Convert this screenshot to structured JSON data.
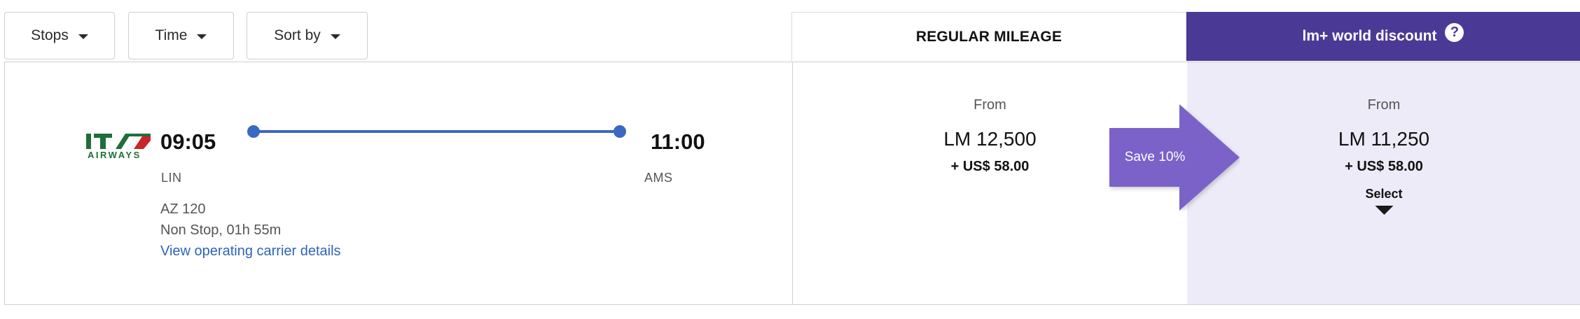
{
  "filters": {
    "stops_label": "Stops",
    "time_label": "Time",
    "sort_label": "Sort by"
  },
  "columns": {
    "regular_title": "REGULAR MILEAGE",
    "discount_title": "lm+ world discount",
    "help_symbol": "?"
  },
  "flight": {
    "airline_logo_text": "AIRWAYS",
    "departure_time": "09:05",
    "arrival_time": "11:00",
    "origin": "LIN",
    "destination": "AMS",
    "flight_number": "AZ 120",
    "duration": "Non Stop, 01h 55m",
    "carrier_link": "View operating carrier details"
  },
  "fares": {
    "regular": {
      "from_label": "From",
      "miles": "LM 12,500",
      "tax": "+ US$ 58.00"
    },
    "discount": {
      "from_label": "From",
      "miles": "LM 11,250",
      "tax": "+ US$ 58.00",
      "select_label": "Select"
    },
    "save_badge": "Save 10%"
  },
  "colors": {
    "brand_purple": "#4a3a96",
    "badge_purple": "#7a62c9",
    "route_blue": "#3a68c3",
    "link_blue": "#2f63b8",
    "discount_bg": "#ecebf7",
    "ita_green": "#1f6e3a",
    "ita_red": "#c8262a"
  }
}
